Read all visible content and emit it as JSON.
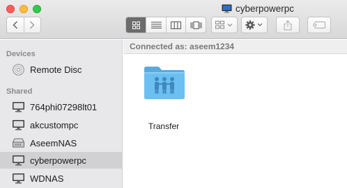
{
  "window": {
    "title": "cyberpowerpc",
    "title_icon": "computer-monitor-icon"
  },
  "toolbar": {
    "back_icon": "chevron-left-icon",
    "forward_icon": "chevron-right-icon",
    "view_modes": [
      "icon-view",
      "list-view",
      "column-view",
      "cover-flow-view"
    ],
    "active_view": "icon-view",
    "arrange_icon": "arrange-grid-icon",
    "action_icon": "gear-icon",
    "share_icon": "share-icon",
    "tag_icon": "tag-icon"
  },
  "sidebar": {
    "devices_header": "Devices",
    "devices": [
      {
        "label": "Remote Disc",
        "icon": "optical-disc-icon"
      }
    ],
    "shared_header": "Shared",
    "shared": [
      {
        "label": "764phi07298lt01",
        "icon": "computer-monitor-icon"
      },
      {
        "label": "akcustompc",
        "icon": "computer-monitor-icon"
      },
      {
        "label": "AseemNAS",
        "icon": "nas-server-icon"
      },
      {
        "label": "cyberpowerpc",
        "icon": "computer-monitor-icon",
        "selected": true
      },
      {
        "label": "WDNAS",
        "icon": "computer-monitor-icon"
      }
    ]
  },
  "main": {
    "connection_status": "Connected as: aseem1234",
    "items": [
      {
        "label": "Transfer",
        "icon": "shared-folder-icon"
      }
    ]
  },
  "colors": {
    "selection": "#d1d0d2",
    "folder": "#68bdf0",
    "close": "#fc605b",
    "minimize": "#fdbc40",
    "maximize": "#34c84a"
  }
}
